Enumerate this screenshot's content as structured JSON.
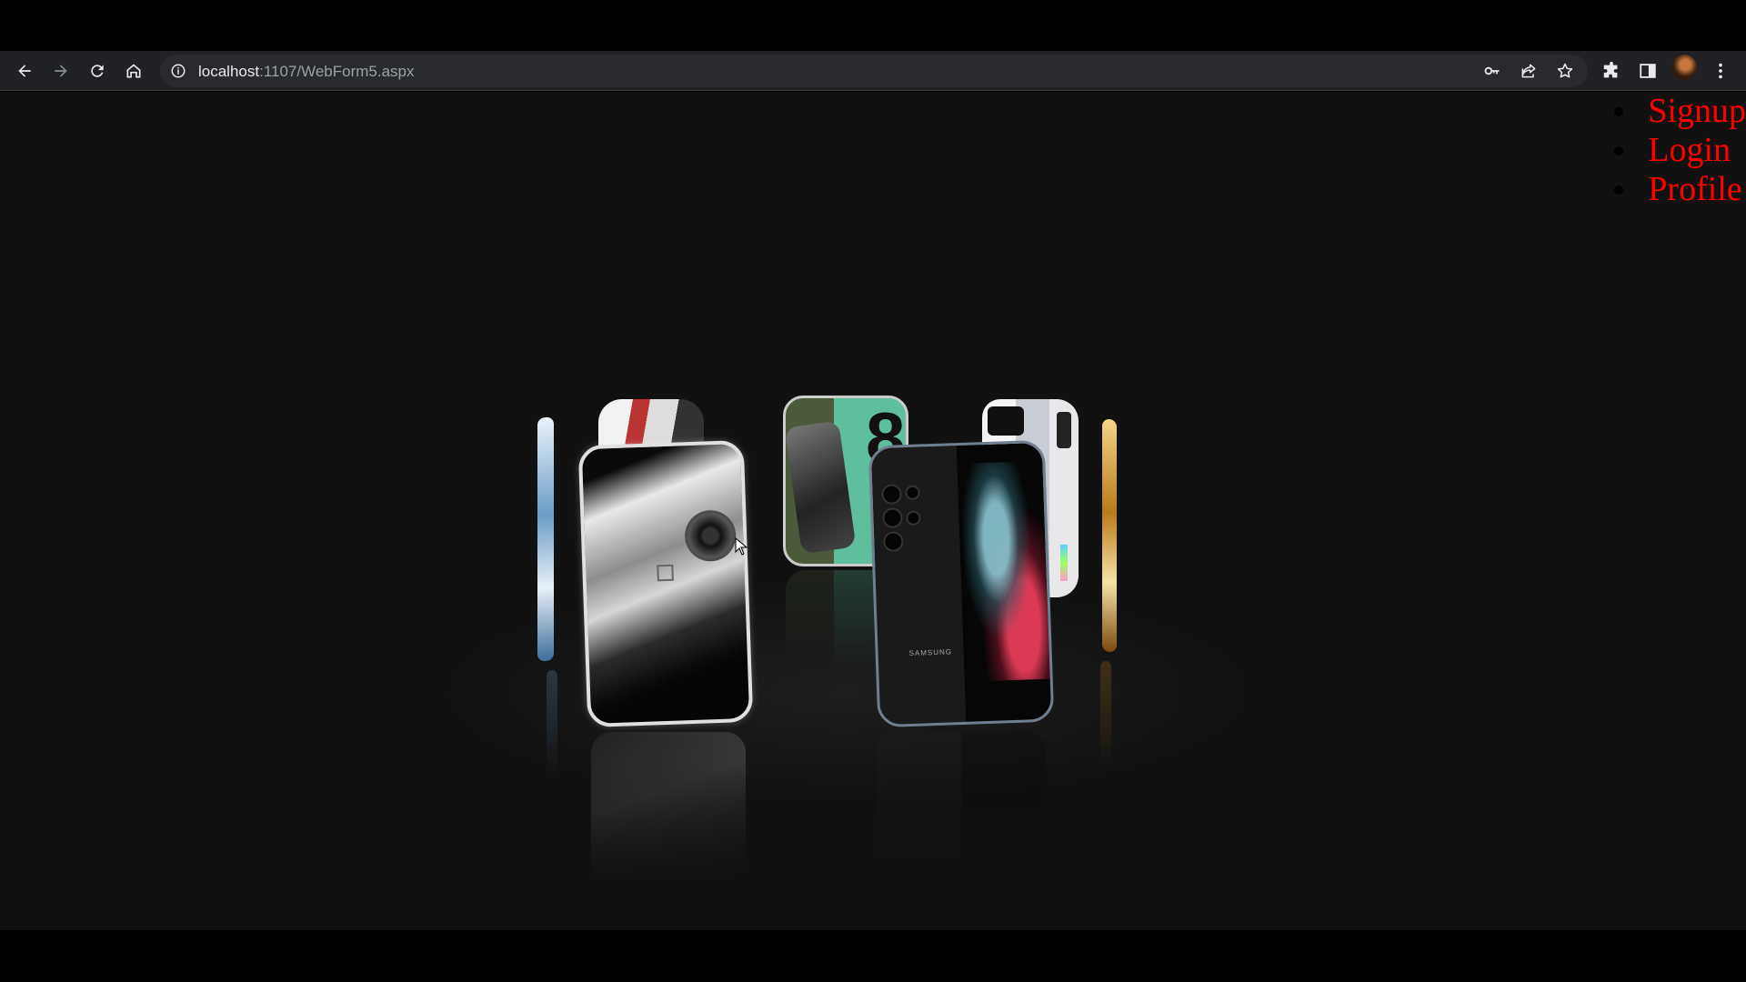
{
  "browser": {
    "url_host": "localhost",
    "url_path": ":1107/WebForm5.aspx"
  },
  "nav_menu": {
    "items": [
      {
        "label": "Signup"
      },
      {
        "label": "Login"
      },
      {
        "label": "Profile"
      }
    ]
  },
  "carousel": {
    "phones": [
      {
        "name": "far-left-phone",
        "screen": "blue-white"
      },
      {
        "name": "back-left-phone",
        "screen": "white-red"
      },
      {
        "name": "back-center-phone",
        "screen": "green-8"
      },
      {
        "name": "back-right-phone",
        "screen": "white-silver"
      },
      {
        "name": "far-right-phone",
        "screen": "gold"
      },
      {
        "name": "front-left-phone",
        "screen": "silver-camera"
      },
      {
        "name": "front-right-phone",
        "screen": "black-splash"
      }
    ],
    "front_right_brand_text": "SAMSUNG"
  },
  "colors": {
    "menu_link": "#ff0000",
    "page_background": "#111111",
    "toolbar": "#202124"
  }
}
